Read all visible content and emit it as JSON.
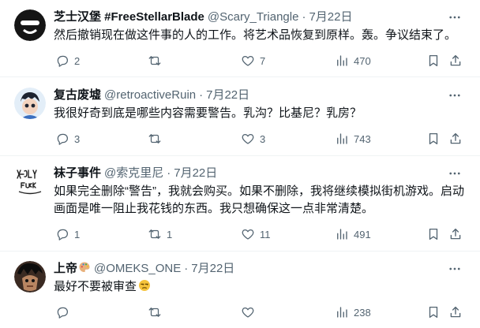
{
  "tweets": [
    {
      "author": "芝士汉堡 #FreeStellarBlade",
      "handle": "@Scary_Triangle",
      "date": "7月22日",
      "text": "然后撤销现在做这件事的人的工作。将艺术品恢复到原样。轰。争议结束了。",
      "replies": "2",
      "retweets": "",
      "likes": "7",
      "views": "470"
    },
    {
      "author": "复古废墟",
      "handle": "@retroactiveRuin",
      "date": "7月22日",
      "text": "我很好奇到底是哪些内容需要警告。乳沟？比基尼？乳房？",
      "replies": "3",
      "retweets": "",
      "likes": "3",
      "views": "743"
    },
    {
      "author": "袜子事件",
      "handle": "@索克里尼",
      "date": "7月22日",
      "text": "如果完全删除“警告”，我就会购买。如果不删除，我将继续模拟街机游戏。启动画面是唯一阻止我花钱的东西。我只想确保这一点非常清楚。",
      "replies": "1",
      "retweets": "1",
      "likes": "11",
      "views": "491"
    },
    {
      "author": "上帝",
      "handle": "@OMEKS_ONE",
      "date": "7月22日",
      "text": "最好不要被审查",
      "replies": "",
      "retweets": "",
      "likes": "",
      "views": "238"
    }
  ],
  "icons": {
    "reply": "reply-icon",
    "retweet": "retweet-icon",
    "like": "heart-icon",
    "views": "views-icon",
    "bookmark": "bookmark-icon",
    "share": "share-icon",
    "more": "more-icon"
  },
  "colors": {
    "text": "#0f1419",
    "muted": "#536471",
    "divider": "#eff3f4"
  }
}
